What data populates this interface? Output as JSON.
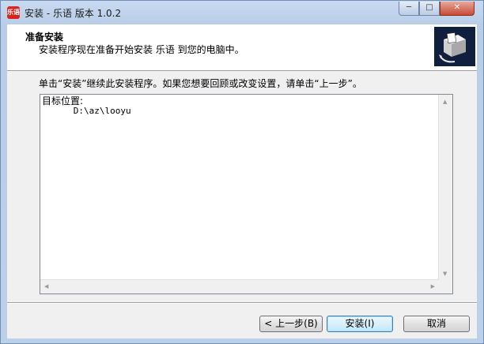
{
  "window": {
    "title": "安装 - 乐语 版本 1.0.2",
    "app_icon_text": "乐语",
    "controls": {
      "minimize": "─",
      "maximize": "□",
      "close": "✕"
    }
  },
  "header": {
    "title": "准备安装",
    "subtitle": "安装程序现在准备开始安装 乐语 到您的电脑中。",
    "logo_icon": "installer-box-icon"
  },
  "body": {
    "message": "单击“安装”继续此安装程序。如果您想要回顾或改变设置，请单击“上一步”。"
  },
  "memo": {
    "label": "目标位置:",
    "value": "      D:\\az\\looyu"
  },
  "buttons": {
    "back": "< 上一步(B)",
    "install": "安装(I)",
    "cancel": "取消"
  },
  "colors": {
    "titlebar": "#bcd0ea",
    "close_button": "#c74a36",
    "header_bg": "#ffffff",
    "dialog_bg": "#f0f0f0",
    "default_button_border": "#3c7fb1"
  }
}
